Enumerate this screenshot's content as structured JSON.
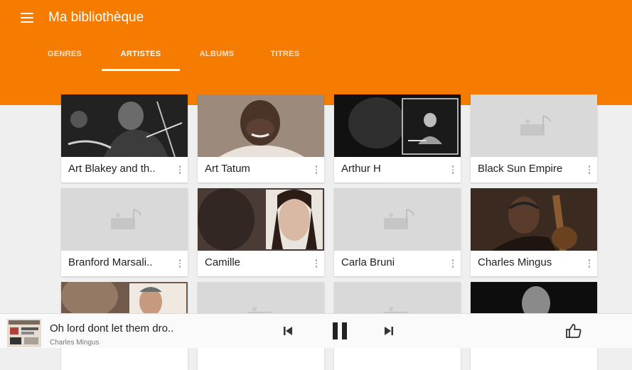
{
  "header": {
    "title": "Ma bibliothèque",
    "menu_icon": "hamburger-menu-icon"
  },
  "tabs": [
    {
      "label": "GENRES",
      "active": false
    },
    {
      "label": "ARTISTES",
      "active": true
    },
    {
      "label": "ALBUMS",
      "active": false
    },
    {
      "label": "TITRES",
      "active": false
    }
  ],
  "artists": [
    {
      "name": "Art Blakey and th..",
      "art": "photo"
    },
    {
      "name": "Art Tatum",
      "art": "photo"
    },
    {
      "name": "Arthur H",
      "art": "album-cover"
    },
    {
      "name": "Black Sun Empire",
      "art": "placeholder"
    },
    {
      "name": "Branford Marsali..",
      "art": "placeholder"
    },
    {
      "name": "Camille",
      "art": "photo"
    },
    {
      "name": "Carla Bruni",
      "art": "placeholder"
    },
    {
      "name": "Charles Mingus",
      "art": "photo"
    },
    {
      "name": "",
      "art": "photo"
    },
    {
      "name": "",
      "art": "placeholder"
    },
    {
      "name": "",
      "art": "placeholder"
    },
    {
      "name": "",
      "art": "photo"
    }
  ],
  "player": {
    "track_title": "Oh lord dont let them dro..",
    "track_artist": "Charles Mingus",
    "state": "playing",
    "icons": [
      "previous-icon",
      "pause-icon",
      "next-icon",
      "thumbs-up-icon"
    ]
  },
  "colors": {
    "accent": "#f57c00",
    "background": "#efefef",
    "card": "#ffffff"
  }
}
